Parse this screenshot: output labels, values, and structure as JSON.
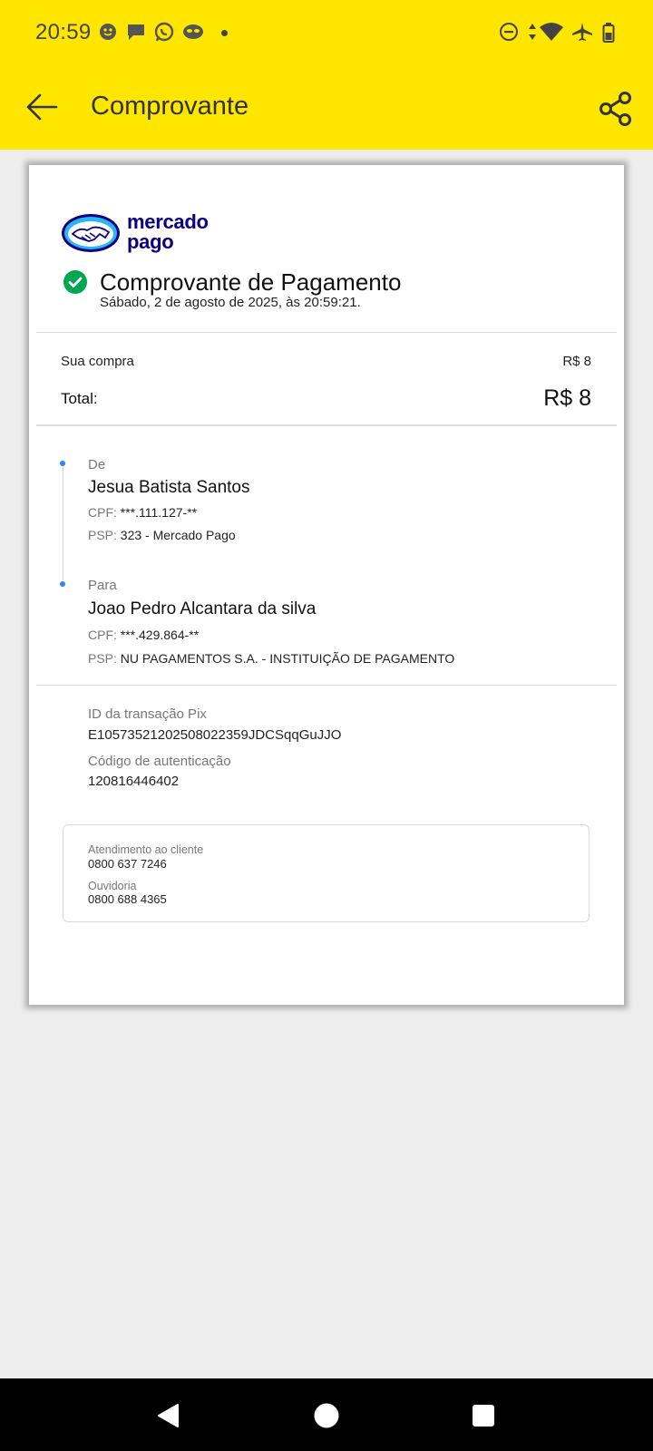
{
  "status_bar": {
    "time": "20:59",
    "notification_icons": [
      "messenger-icon",
      "chat-icon",
      "whatsapp-icon",
      "mask-icon"
    ],
    "system_icons": [
      "do-not-disturb-icon",
      "data-arrows-icon",
      "wifi-icon",
      "airplane-icon",
      "battery-icon"
    ]
  },
  "app_bar": {
    "title": "Comprovante"
  },
  "receipt": {
    "logo_text_line1": "mercado",
    "logo_text_line2": "pago",
    "title": "Comprovante de Pagamento",
    "datetime": "Sábado, 2 de agosto de 2025, às 20:59:21.",
    "purchase_label": "Sua compra",
    "purchase_value": "R$ 8",
    "total_label": "Total:",
    "total_value": "R$ 8",
    "from": {
      "label": "De",
      "name": "Jesua Batista Santos",
      "cpf_key": "CPF:",
      "cpf_value": "***.111.127-**",
      "psp_key": "PSP:",
      "psp_value": "323 - Mercado Pago"
    },
    "to": {
      "label": "Para",
      "name": "Joao Pedro Alcantara da silva",
      "cpf_key": "CPF:",
      "cpf_value": "***.429.864-**",
      "psp_key": "PSP:",
      "psp_value": "NU PAGAMENTOS S.A. - INSTITUIÇÃO DE PAGAMENTO"
    },
    "transaction_id_label": "ID da transação Pix",
    "transaction_id_value": "E10573521202508022359JDCSqqGuJJO",
    "auth_code_label": "Código de autenticação",
    "auth_code_value": "120816446402",
    "support": {
      "customer_label": "Atendimento ao cliente",
      "customer_phone": "0800 637 7246",
      "ombudsman_label": "Ouvidoria",
      "ombudsman_phone": "0800 688 4365"
    }
  },
  "colors": {
    "header": "#ffe600",
    "brand_blue": "#0a0080",
    "success": "#00a650",
    "timeline_dot": "#3483fa"
  }
}
